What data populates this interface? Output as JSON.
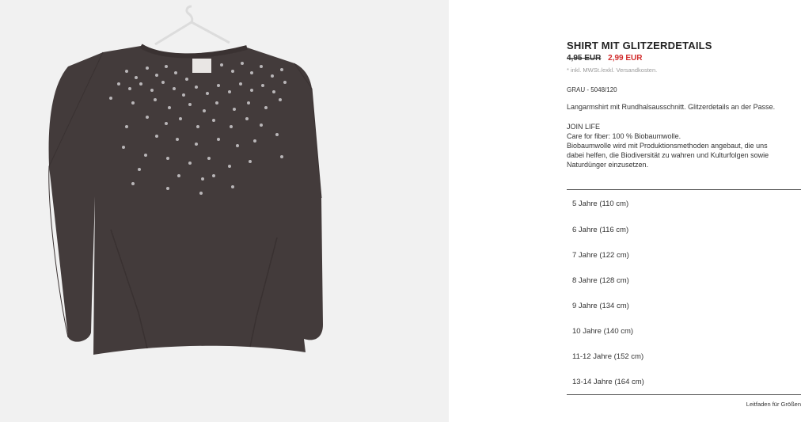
{
  "product": {
    "title": "SHIRT MIT GLITZERDETAILS",
    "old_price": "4,95 EUR",
    "new_price": "2,99 EUR",
    "tax_note": "* inkl. MWSt./exkl. Versandkosten.",
    "color_ref": "GRAU - 5048/120",
    "description": "Langarmshirt mit Rundhalsausschnitt. Glitzerdetails an der Passe.",
    "care": {
      "line1": "JOIN LIFE",
      "line2": "Care for fiber: 100 % Biobaumwolle.",
      "line3": "Biobaumwolle wird mit Produktionsmethoden angebaut, die uns",
      "line4": "dabei helfen, die Biodiversität zu wahren und Kulturfolgen sowie",
      "line5": "Naturdünger einzusetzen."
    }
  },
  "sizes": [
    "5 Jahre (110 cm)",
    "6 Jahre (116 cm)",
    "7 Jahre (122 cm)",
    "8 Jahre (128 cm)",
    "9 Jahre (134 cm)",
    "10 Jahre (140 cm)",
    "11-12 Jahre (152 cm)",
    "13-14 Jahre (164 cm)"
  ],
  "size_guide_label": "Leitfaden für Größen",
  "colors": {
    "price_sale": "#d12b2b",
    "image_background": "#f1f1f1",
    "garment": "#433b3b"
  }
}
